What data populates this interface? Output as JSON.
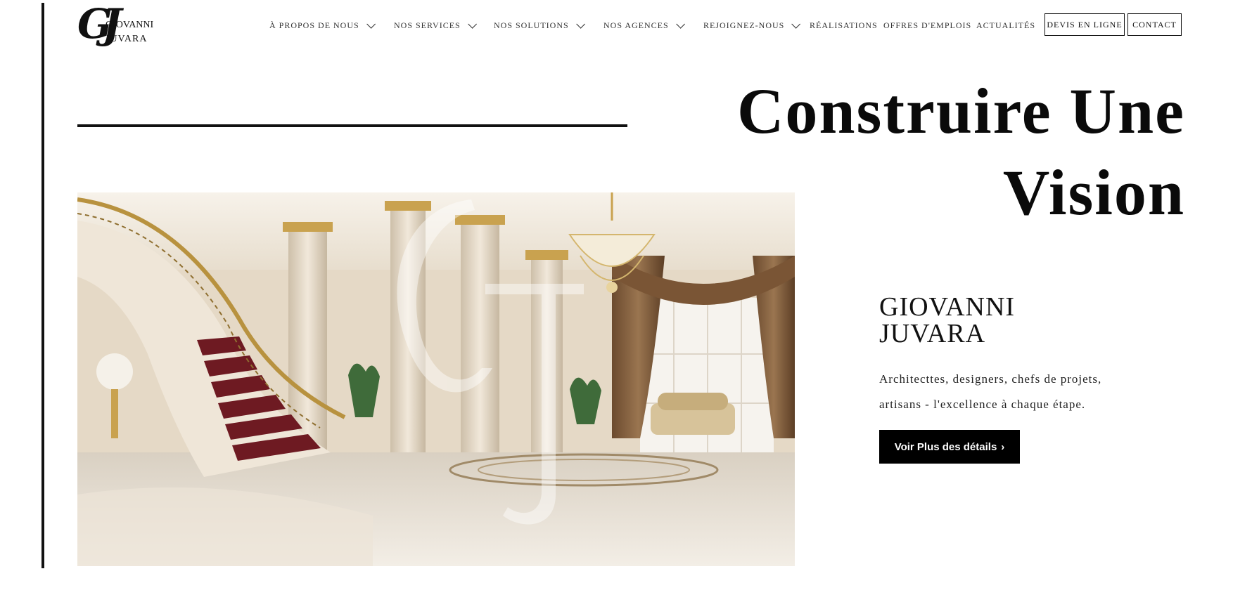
{
  "logo": {
    "monogram": "GJ",
    "line1": "GIOVANNI",
    "line2": "JUVARA"
  },
  "nav": {
    "items": [
      {
        "label": "À PROPOS DE NOUS",
        "has_dropdown": true
      },
      {
        "label": "NOS SERVICES",
        "has_dropdown": true
      },
      {
        "label": "NOS SOLUTIONS",
        "has_dropdown": true
      },
      {
        "label": "NOS AGENCES",
        "has_dropdown": true
      },
      {
        "label": "REJOIGNEZ-NOUS",
        "has_dropdown": true
      },
      {
        "label": "RÉALISATIONS",
        "has_dropdown": false
      },
      {
        "label": "OFFRES D'EMPLOIS",
        "has_dropdown": false
      },
      {
        "label": "ACTUALITÉS",
        "has_dropdown": false
      }
    ],
    "devis_label": "DEVIS EN LIGNE",
    "contact_label": "CONTACT"
  },
  "hero": {
    "title_line1": "Construire Une",
    "title_line2": "Vision",
    "image_alt": "Luxury marble hall with staircase and chandeliers",
    "brand_line1": "GIOVANNI",
    "brand_line2": "JUVARA",
    "description_line1": "Architecttes, designers, chefs de projets,",
    "description_line2": "artisans - l'excellence à chaque étape.",
    "cta_label": "Voir Plus des détails",
    "cta_icon": "chevron-right-icon"
  },
  "colors": {
    "text": "#111111",
    "cta_bg": "#000000",
    "cta_text": "#ffffff"
  }
}
